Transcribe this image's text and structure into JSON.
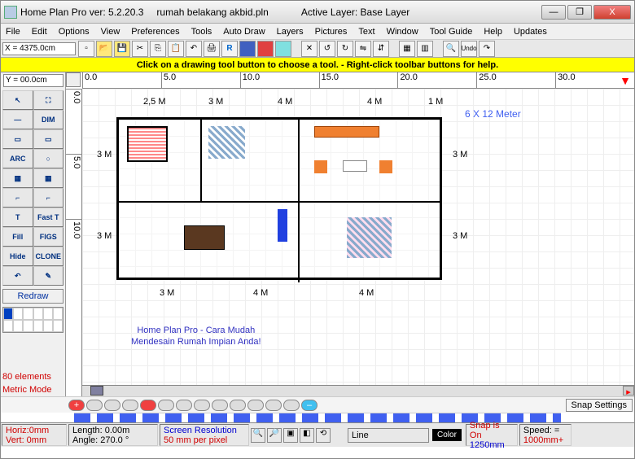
{
  "title": {
    "app": "Home Plan Pro ver: 5.2.20.3",
    "file": "rumah belakang akbid.pln",
    "layer": "Active Layer: Base Layer"
  },
  "winbtns": {
    "min": "—",
    "max": "❐",
    "close": "X"
  },
  "menu": [
    "File",
    "Edit",
    "Options",
    "View",
    "Preferences",
    "Tools",
    "Auto Draw",
    "Layers",
    "Pictures",
    "Text",
    "Window",
    "Tool Guide",
    "Help",
    "Updates"
  ],
  "coords": {
    "x": "X = 4375.0cm",
    "y": "Y = 00.0cm"
  },
  "yellowbar": "Click on a drawing tool button to choose a tool.  -  Right-click toolbar buttons for help.",
  "ruler_h": [
    "0.0",
    "5.0",
    "10.0",
    "15.0",
    "20.0",
    "25.0",
    "30.0"
  ],
  "ruler_v": [
    "0.0",
    "5.0",
    "10.0"
  ],
  "tools": [
    "↖",
    "⛶",
    "—",
    "DIM",
    "▭",
    "▭",
    "ARC",
    "○",
    "▦",
    "▦",
    "⌐",
    "⌐",
    "T",
    "Fast T",
    "Fill",
    "FIGS",
    "Hide",
    "CLONE",
    "↶",
    "✎"
  ],
  "redraw": "Redraw",
  "dims": {
    "top1": "2,5 M",
    "top2": "3 M",
    "top3": "4 M",
    "top4": "4 M",
    "topR": "1 M",
    "left1": "3 M",
    "left2": "3 M",
    "right1": "3 M",
    "right2": "3 M",
    "bot1": "3 M",
    "bot2": "4 M",
    "bot3": "4 M"
  },
  "meterlabel": "6 X 12 Meter",
  "headline1": "Home Plan Pro - Cara Mudah",
  "headline2": "Mendesain Rumah Impian Anda!",
  "bottom": {
    "elements": "80 elements",
    "metric": "Metric Mode",
    "snap": "Snap Settings"
  },
  "status": {
    "horiz": "Horiz:0mm",
    "vert": "Vert: 0mm",
    "length": "Length:  0.00m",
    "angle": "Angle: 270.0 °",
    "res1": "Screen Resolution",
    "res2": "50 mm per pixel",
    "line": "Line",
    "color": "Color",
    "snap1": "Snap is On",
    "snap2": "1250mm",
    "speed1": "Speed: =",
    "speed2": "1000mm+"
  }
}
